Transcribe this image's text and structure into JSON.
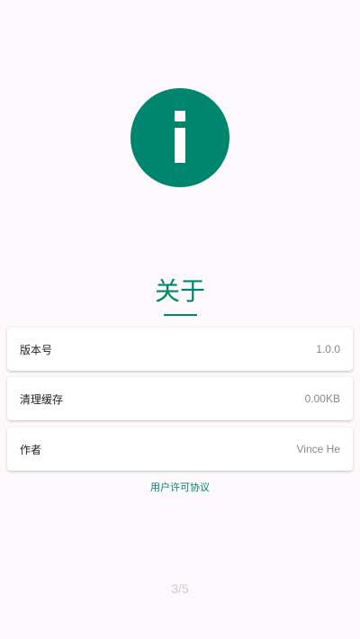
{
  "header": {
    "icon": "info-icon",
    "title": "关于"
  },
  "settings": [
    {
      "label": "版本号",
      "value": "1.0.0"
    },
    {
      "label": "清理缓存",
      "value": "0.00KB"
    },
    {
      "label": "作者",
      "value": "Vince He"
    }
  ],
  "license_link": "用户许可协议",
  "pager": {
    "text": "3/5"
  },
  "colors": {
    "accent": "#00856f",
    "background": "#fdf8fc",
    "card": "#ffffff",
    "muted_text": "#888888",
    "pager_text": "#cccccc"
  }
}
